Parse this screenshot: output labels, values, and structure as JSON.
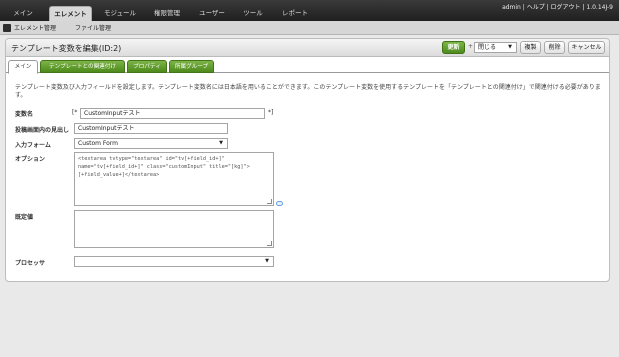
{
  "nav": {
    "tabs": [
      "メイン",
      "エレメント",
      "モジュール",
      "権限管理",
      "ユーザー",
      "ツール",
      "レポート"
    ],
    "user_info": "admin | ヘルプ | ログアウト | 1.0.14J-9"
  },
  "subnav": {
    "items": [
      "エレメント管理",
      "ファイル管理"
    ]
  },
  "panel": {
    "title": "テンプレート変数を編集(ID:2)",
    "save_label": "更新",
    "select_value": "閉じる",
    "copy_label": "複製",
    "delete_label": "削除",
    "cancel_label": "キャンセル"
  },
  "tabs": [
    "メイン",
    "テンプレートとの関連付け",
    "プロパティ",
    "所属グループ"
  ],
  "form": {
    "description": "テンプレート変数及び入力フィールドを設定します。テンプレート変数名には日本語を用いることができます。このテンプレート変数を使用するテンプレートを「テンプレートとの関連付け」で関連付ける必要があります。",
    "var_name_label": "変数名",
    "var_name_prefix": "[*",
    "var_name_value": "CustomInputテスト",
    "var_name_suffix": "*]",
    "caption_label": "投稿画面内の見出し",
    "caption_value": "CustomInputテスト",
    "input_type_label": "入力フォーム",
    "input_type_value": "Custom Form",
    "options_label": "オプション",
    "options_code": "<textarea tvtype=\"textarea\" id=\"tv[+field_id+]\" name=\"tv[+field_id+]\" class=\"customInput\" title=\"[kg]\">[+field_value+]</textarea>",
    "default_label": "既定値",
    "default_value": "",
    "processor_label": "プロセッサ",
    "processor_value": ""
  }
}
